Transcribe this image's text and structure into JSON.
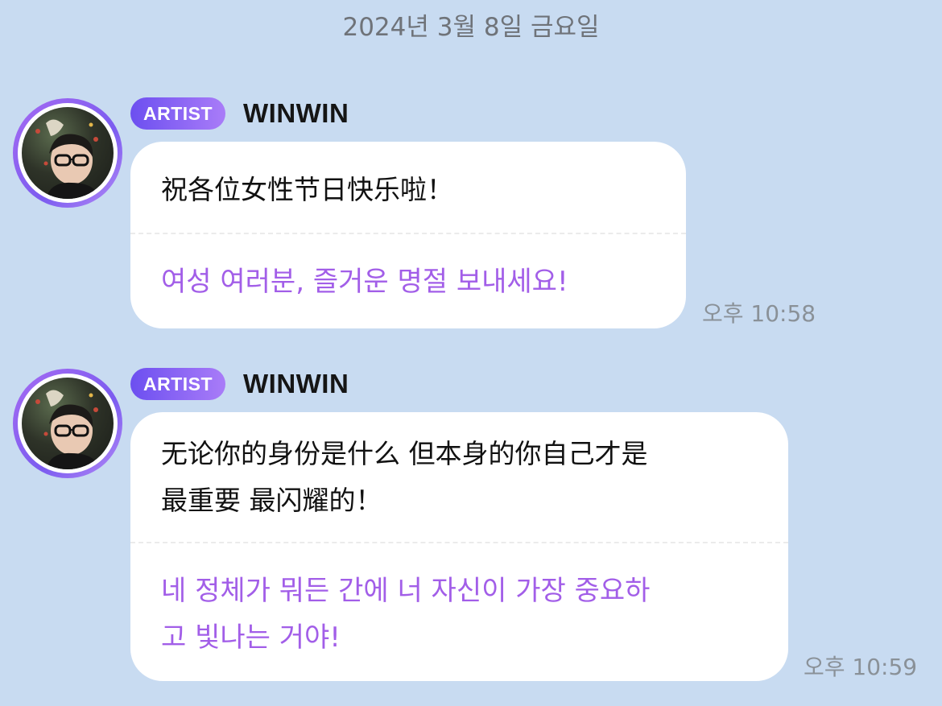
{
  "chat": {
    "date_header": "2024년 3월 8일 금요일",
    "messages": [
      {
        "badge": "ARTIST",
        "sender": "WINWIN",
        "original_lines": [
          "祝各位女性节日快乐啦！"
        ],
        "translation_lines": [
          "여성 여러분, 즐거운 명절 보내세요!"
        ],
        "time": "오후 10:58"
      },
      {
        "badge": "ARTIST",
        "sender": "WINWIN",
        "original_lines": [
          "无论你的身份是什么 但本身的你自己才是",
          "最重要 最闪耀的！"
        ],
        "translation_lines": [
          "네 정체가 뭐든 간에 너 자신이 가장 중요하",
          "고 빛나는 거야!"
        ],
        "time": "오후 10:59"
      }
    ]
  }
}
